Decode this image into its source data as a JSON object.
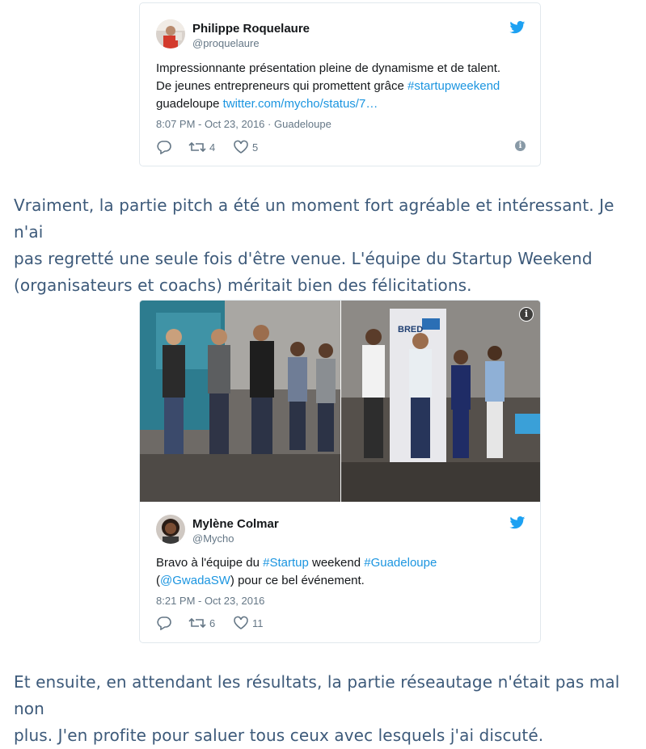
{
  "tweet1": {
    "author_name": "Philippe Roquelaure",
    "author_handle": "@proquelaure",
    "text_line1": "Impressionnante présentation pleine de dynamisme et de talent.",
    "text_line2_plain": "De jeunes entrepreneurs qui promettent grâce ",
    "text_line2_hashtag": "#startupweekend",
    "text_line3_plain": "guadeloupe ",
    "text_line3_link": "twitter.com/mycho/status/7…",
    "timestamp": "8:07 PM - Oct 23, 2016",
    "separator": "·",
    "location": "Guadeloupe",
    "retweets": "4",
    "likes": "5"
  },
  "paragraph1": {
    "line1": "Vraiment, la partie pitch a été un moment fort agréable et intéressant. Je n'ai",
    "line2": "pas regretté une seule fois d'être venue. L'équipe du Startup Weekend",
    "line3": "(organisateurs et coachs) méritait bien des félicitations."
  },
  "tweet2": {
    "author_name": "Mylène Colmar",
    "author_handle": "@Mycho",
    "text_l1_a": "Bravo à l'équipe du ",
    "text_l1_hashtag1": "#Startup",
    "text_l1_b": " weekend ",
    "text_l1_hashtag2": "#Guadeloupe",
    "text_l2_open": "(",
    "text_l2_mention": "@GwadaSW",
    "text_l2_rest": ") pour ce bel événement.",
    "timestamp": "8:21 PM - Oct 23, 2016",
    "retweets": "6",
    "likes": "11",
    "photo_banner_text": "BRED"
  },
  "paragraph2": {
    "line1": "Et ensuite, en attendant les résultats, la partie réseautage n'était pas mal non",
    "line2": "plus. J'en profite pour saluer tous ceux avec lesquels j'ai discuté."
  },
  "icons": {
    "info_glyph": "i"
  },
  "colors": {
    "link": "#1b95e0",
    "paragraph": "#3d5a7a",
    "meta": "#657786"
  }
}
